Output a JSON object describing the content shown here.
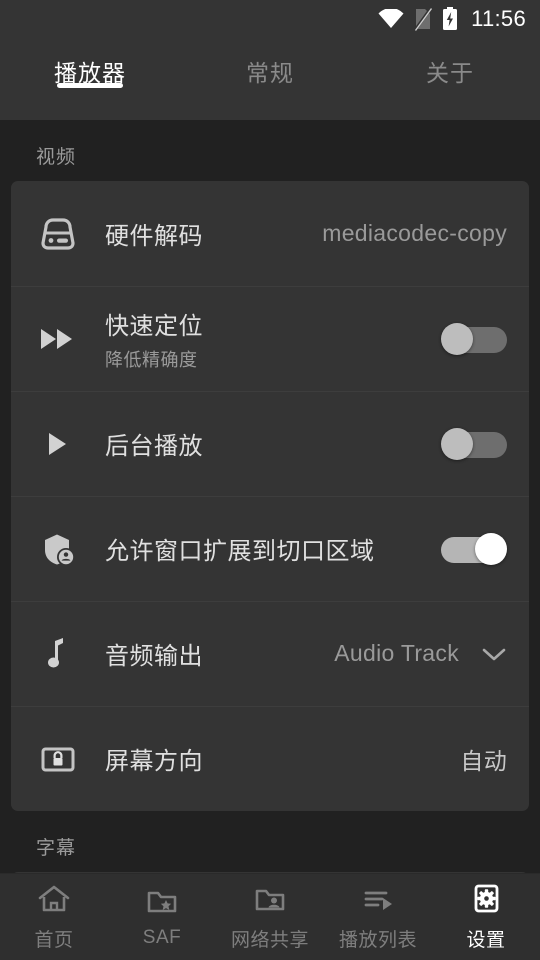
{
  "status_bar": {
    "time": "11:56",
    "icons": [
      "wifi-icon",
      "sim-off-icon",
      "battery-charging-icon"
    ]
  },
  "tabs": [
    {
      "label": "播放器",
      "active": true
    },
    {
      "label": "常规",
      "active": false
    },
    {
      "label": "关于",
      "active": false
    }
  ],
  "sections": [
    {
      "title": "视频",
      "rows": [
        {
          "icon": "hard-drive-icon",
          "title": "硬件解码",
          "sub": "",
          "value": "mediacodec-copy",
          "control": "value"
        },
        {
          "icon": "fast-forward-icon",
          "title": "快速定位",
          "sub": "降低精确度",
          "value": "",
          "control": "toggle",
          "toggle_on": false
        },
        {
          "icon": "play-icon",
          "title": "后台播放",
          "sub": "",
          "value": "",
          "control": "toggle",
          "toggle_on": false
        },
        {
          "icon": "shield-person-icon",
          "title": "允许窗口扩展到切口区域",
          "sub": "",
          "value": "",
          "control": "toggle",
          "toggle_on": true
        },
        {
          "icon": "music-note-icon",
          "title": "音频输出",
          "sub": "",
          "value": "Audio Track",
          "control": "dropdown"
        },
        {
          "icon": "screen-lock-icon",
          "title": "屏幕方向",
          "sub": "",
          "value": "自动",
          "control": "value-bright"
        }
      ]
    },
    {
      "title": "字幕",
      "rows": []
    }
  ],
  "bottom_nav": [
    {
      "label": "首页",
      "icon": "home-icon",
      "active": false
    },
    {
      "label": "SAF",
      "icon": "folder-star-icon",
      "active": false
    },
    {
      "label": "网络共享",
      "icon": "folder-person-icon",
      "active": false
    },
    {
      "label": "播放列表",
      "icon": "playlist-play-icon",
      "active": false
    },
    {
      "label": "设置",
      "icon": "settings-gear-icon",
      "active": true
    }
  ],
  "colors": {
    "page_background": "#212121",
    "card_background": "#343434",
    "bar_background": "#343434",
    "nav_background": "#2f2f2f",
    "accent_white": "#ffffff",
    "muted_text": "#9a9a9a",
    "primary_text": "#e0e0e0"
  }
}
